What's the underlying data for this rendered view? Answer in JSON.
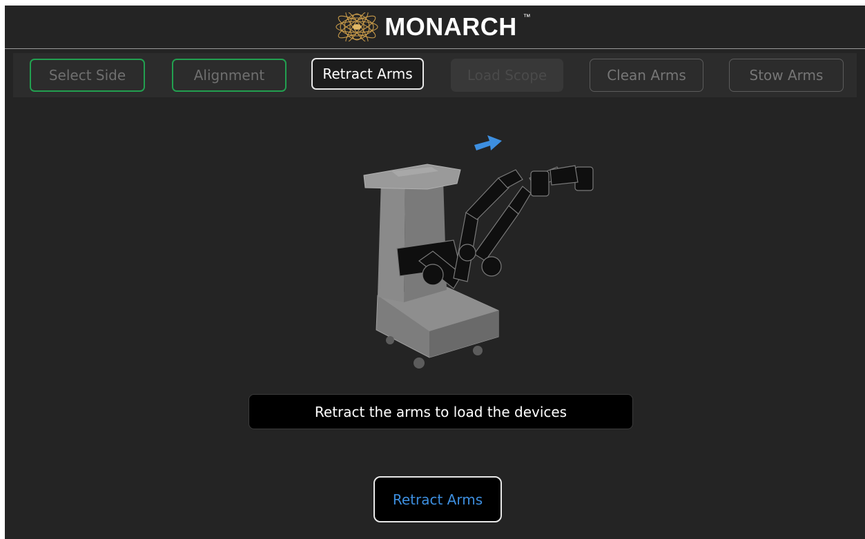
{
  "header": {
    "brand": "MONARCH",
    "trademark": "™",
    "logo_icon": "monarch-butterfly-logo",
    "colors": {
      "logo": "#c89b4a"
    }
  },
  "steps": [
    {
      "label": "Select Side",
      "state": "completed"
    },
    {
      "label": "Alignment",
      "state": "completed"
    },
    {
      "label": "Retract Arms",
      "state": "current"
    },
    {
      "label": "Load Scope",
      "state": "disabled"
    },
    {
      "label": "Clean Arms",
      "state": "pending"
    },
    {
      "label": "Stow Arms",
      "state": "pending"
    }
  ],
  "illustration": {
    "subject": "robotic-cart-with-arms",
    "direction_icon": "arrow-right-icon",
    "colors": {
      "arrow": "#3d8fe0",
      "cart": "#8a8a8a",
      "arms": "#0a0a0a"
    }
  },
  "instruction": "Retract the arms to load the devices",
  "action_button": {
    "label": "Retract Arms",
    "color": "#3d8fe0"
  },
  "colors": {
    "background": "#242424",
    "completed_border": "#22a050",
    "current_border": "#e8e8e8"
  }
}
